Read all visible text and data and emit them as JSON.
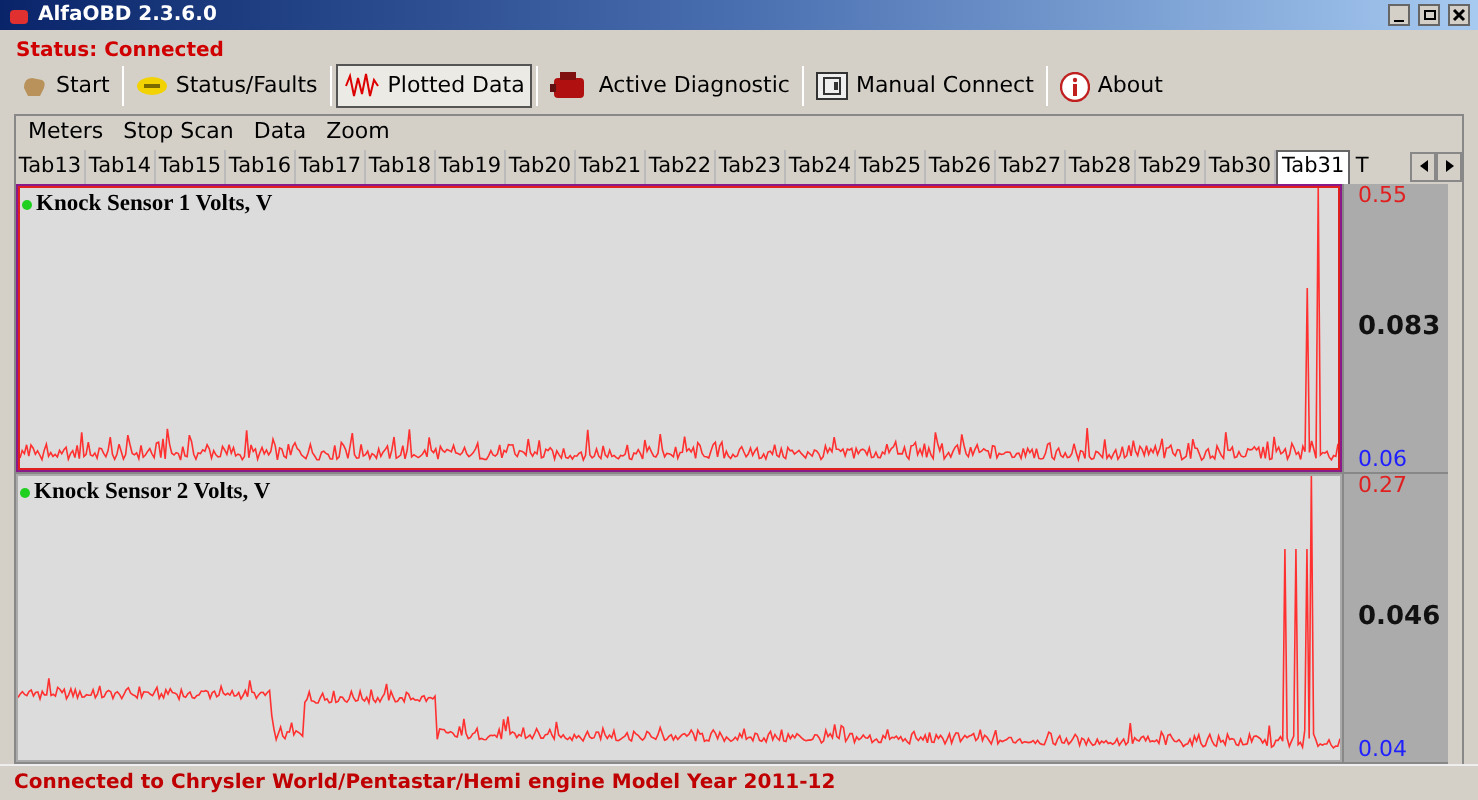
{
  "window": {
    "title": "AlfaOBD 2.3.6.0"
  },
  "status": "Status: Connected",
  "toolbar": [
    {
      "label": "Start",
      "kind": "hand",
      "selected": false
    },
    {
      "label": "Status/Faults",
      "kind": "badge",
      "selected": false
    },
    {
      "label": "Plotted Data",
      "kind": "wave",
      "selected": true
    },
    {
      "label": "Active Diagnostic",
      "kind": "engine",
      "selected": false
    },
    {
      "label": "Manual Connect",
      "kind": "plug",
      "selected": false
    },
    {
      "label": "About",
      "kind": "info",
      "selected": false
    }
  ],
  "menu": [
    "Meters",
    "Stop Scan",
    "Data",
    "Zoom"
  ],
  "tabs": [
    {
      "label": "Tab13",
      "selected": false
    },
    {
      "label": "Tab14",
      "selected": false
    },
    {
      "label": "Tab15",
      "selected": false
    },
    {
      "label": "Tab16",
      "selected": false
    },
    {
      "label": "Tab17",
      "selected": false
    },
    {
      "label": "Tab18",
      "selected": false
    },
    {
      "label": "Tab19",
      "selected": false
    },
    {
      "label": "Tab20",
      "selected": false
    },
    {
      "label": "Tab21",
      "selected": false
    },
    {
      "label": "Tab22",
      "selected": false
    },
    {
      "label": "Tab23",
      "selected": false
    },
    {
      "label": "Tab24",
      "selected": false
    },
    {
      "label": "Tab25",
      "selected": false
    },
    {
      "label": "Tab26",
      "selected": false
    },
    {
      "label": "Tab27",
      "selected": false
    },
    {
      "label": "Tab28",
      "selected": false
    },
    {
      "label": "Tab29",
      "selected": false
    },
    {
      "label": "Tab30",
      "selected": false
    },
    {
      "label": "Tab31",
      "selected": true
    },
    {
      "label": "T",
      "selected": false
    }
  ],
  "plots": [
    {
      "title": "Knock Sensor 1 Volts, V",
      "max": "0.55",
      "min": "0.06",
      "value": "0.083",
      "selected": true
    },
    {
      "title": "Knock Sensor 2 Volts, V",
      "max": "0.27",
      "min": "0.04",
      "value": "0.046",
      "selected": false
    }
  ],
  "status_bar": "Connected to Chrysler World/Pentastar/Hemi engine Model Year 2011-12"
}
